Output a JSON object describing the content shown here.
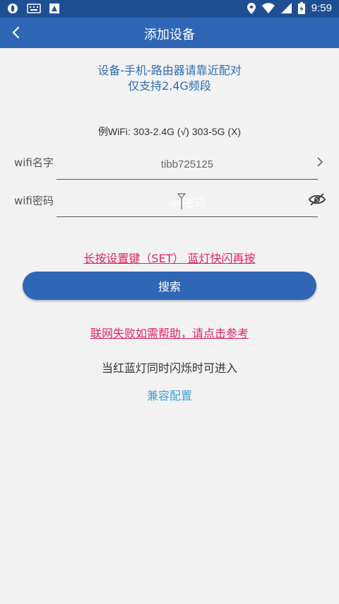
{
  "statusbar": {
    "time": "9:59",
    "left_icons": [
      "swirl-app-icon",
      "keyboard-icon",
      "store-icon"
    ],
    "right_icons": [
      "location-icon",
      "wifi-icon",
      "signal-icon",
      "battery-icon"
    ]
  },
  "toolbar": {
    "title": "添加设备"
  },
  "hints": {
    "line1": "设备-手机-路由器请靠近配对",
    "line2": "仅支持2.4G频段",
    "example": "例WiFi: 303-2.4G (√) 303-5G (X)"
  },
  "form": {
    "wifi_name_label": "wifi名字",
    "wifi_name_value": "tibb725125",
    "wifi_pwd_label": "wifi密码",
    "wifi_pwd_placeholder": "wifi密码"
  },
  "actions": {
    "longpress_hint": "长按设置键（SET） 蓝灯快闪再按",
    "search_label": "搜索",
    "help_link": "联网失败如需帮助，请点击参考",
    "red_blue_text": "当红蓝灯同时闪烁时可进入",
    "compat_link": "兼容配置"
  },
  "colors": {
    "statusbar": "#1f4f93",
    "toolbar": "#2f66b6",
    "hint_blue": "#2f6db3",
    "link_red": "#e0245e",
    "compat_blue": "#3aa2d8",
    "background": "#f2f2f2"
  }
}
